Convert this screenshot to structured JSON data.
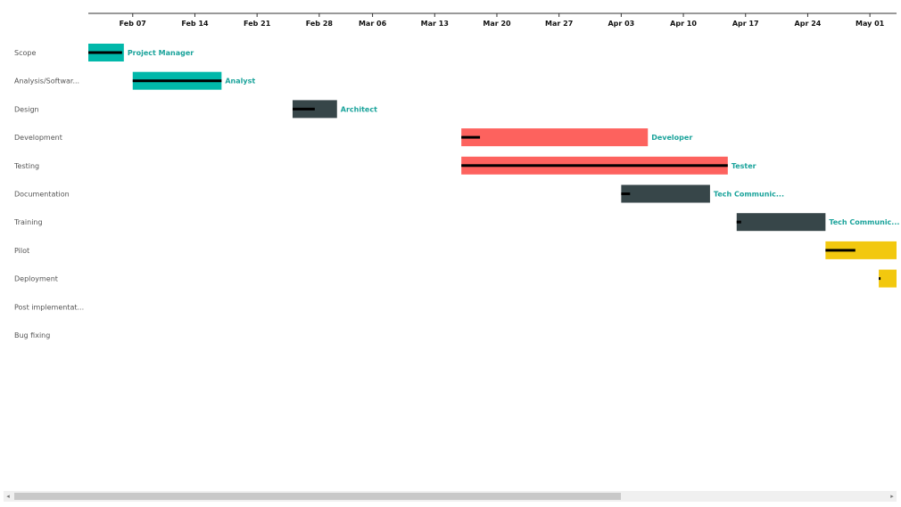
{
  "chart_data": {
    "type": "gantt",
    "x_ticks": [
      "Feb 07",
      "Feb 14",
      "Feb 21",
      "Feb 28",
      "Mar 06",
      "Mar 13",
      "Mar 20",
      "Mar 27",
      "Apr 03",
      "Apr 10",
      "Apr 17",
      "Apr 24",
      "May 01"
    ],
    "x_range": [
      "2019-02-02",
      "2019-05-04"
    ],
    "tasks": [
      {
        "name": "Scope",
        "start": "2019-02-02",
        "end": "2019-02-06",
        "progress": 0.95,
        "resource": "Project Manager",
        "color": "#01b8aa"
      },
      {
        "name": "Analysis/Softwar...",
        "start": "2019-02-07",
        "end": "2019-02-17",
        "progress": 1.0,
        "resource": "Analyst",
        "color": "#01b8aa"
      },
      {
        "name": "Design",
        "start": "2019-02-25",
        "end": "2019-03-02",
        "progress": 0.5,
        "resource": "Architect",
        "color": "#374649"
      },
      {
        "name": "Development",
        "start": "2019-03-16",
        "end": "2019-04-06",
        "progress": 0.1,
        "resource": "Developer",
        "color": "#fd625e"
      },
      {
        "name": "Testing",
        "start": "2019-03-16",
        "end": "2019-04-15",
        "progress": 1.0,
        "resource": "Tester",
        "color": "#fd625e"
      },
      {
        "name": "Documentation",
        "start": "2019-04-03",
        "end": "2019-04-13",
        "progress": 0.1,
        "resource": "Tech Communic...",
        "color": "#374649"
      },
      {
        "name": "Training",
        "start": "2019-04-16",
        "end": "2019-04-26",
        "progress": 0.05,
        "resource": "Tech Communic...",
        "color": "#374649"
      },
      {
        "name": "Pilot",
        "start": "2019-04-26",
        "end": "2019-05-05",
        "progress": 0.42,
        "resource": "",
        "color": "#f2c80f"
      },
      {
        "name": "Deployment",
        "start": "2019-05-02",
        "end": "2019-05-05",
        "progress": 0.05,
        "resource": "",
        "color": "#f2c80f"
      },
      {
        "name": "Post implementat...",
        "start": null,
        "end": null,
        "progress": null,
        "resource": "",
        "color": ""
      },
      {
        "name": "Bug fixing",
        "start": null,
        "end": null,
        "progress": null,
        "resource": "",
        "color": ""
      }
    ]
  },
  "scrollbar": {
    "left_arrow": "◂",
    "right_arrow": "▸"
  }
}
